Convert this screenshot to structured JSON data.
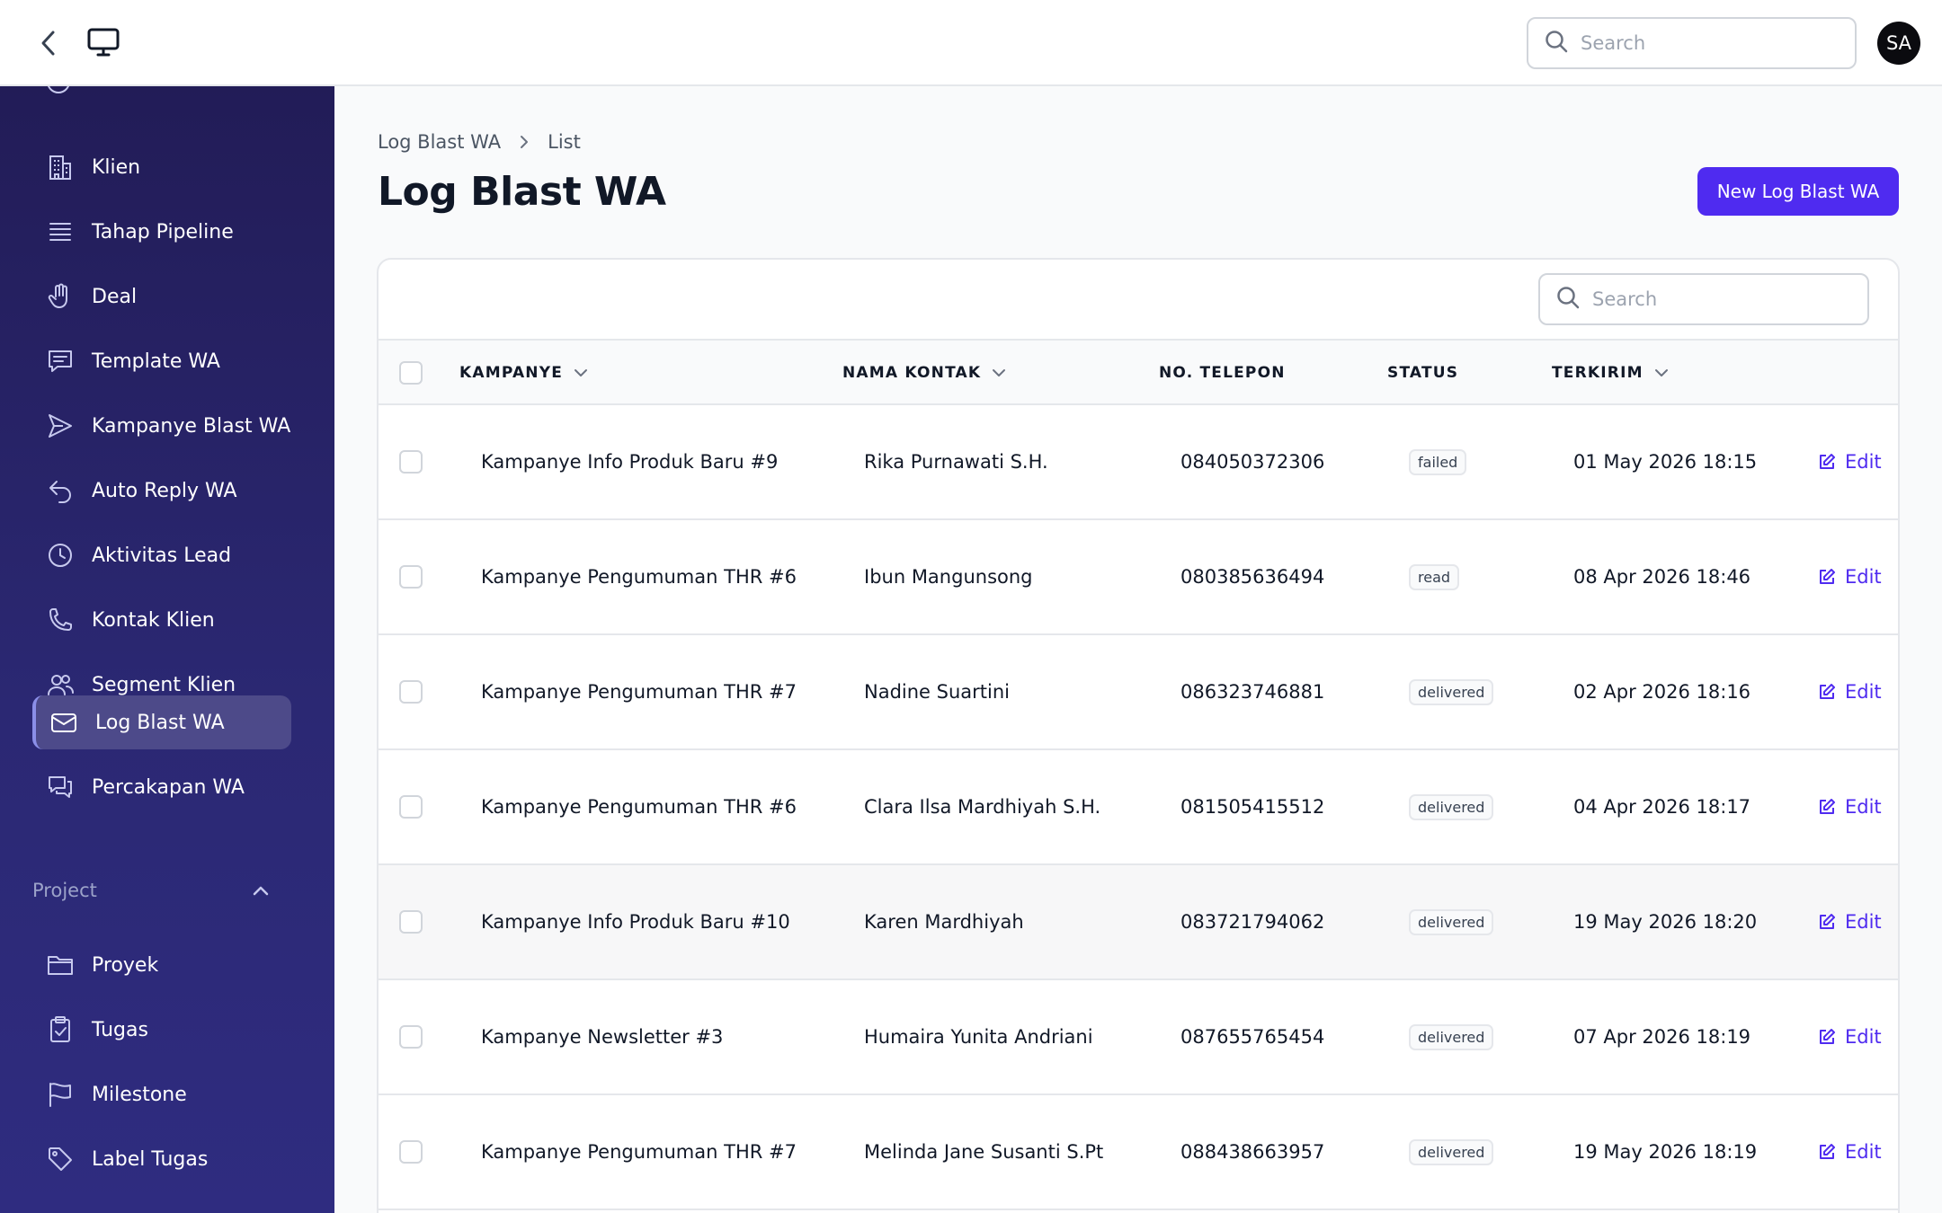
{
  "header": {
    "search_placeholder": "Search",
    "avatar_initials": "SA"
  },
  "sidebar": {
    "items": [
      {
        "label": "Klien",
        "icon": "building-icon"
      },
      {
        "label": "Tahap Pipeline",
        "icon": "list-icon"
      },
      {
        "label": "Deal",
        "icon": "hand-icon"
      },
      {
        "label": "Template WA",
        "icon": "chat-text-icon"
      },
      {
        "label": "Kampanye Blast WA",
        "icon": "send-icon"
      },
      {
        "label": "Auto Reply WA",
        "icon": "reply-icon"
      },
      {
        "label": "Aktivitas Lead",
        "icon": "clock-icon"
      },
      {
        "label": "Kontak Klien",
        "icon": "phone-icon"
      },
      {
        "label": "Segment Klien",
        "icon": "users-icon"
      },
      {
        "label": "Log Blast WA",
        "icon": "envelope-icon",
        "active": true
      },
      {
        "label": "Percakapan WA",
        "icon": "chat-bubbles-icon"
      }
    ],
    "section_label": "Project",
    "project_items": [
      {
        "label": "Proyek",
        "icon": "folder-icon"
      },
      {
        "label": "Tugas",
        "icon": "clipboard-check-icon"
      },
      {
        "label": "Milestone",
        "icon": "flag-icon"
      },
      {
        "label": "Label Tugas",
        "icon": "tag-icon"
      }
    ]
  },
  "breadcrumb": {
    "parent": "Log Blast WA",
    "current": "List"
  },
  "page": {
    "title": "Log Blast WA",
    "new_button": "New Log Blast WA"
  },
  "table": {
    "search_placeholder": "Search",
    "columns": [
      "KAMPANYE",
      "NAMA KONTAK",
      "NO. TELEPON",
      "STATUS",
      "TERKIRIM"
    ],
    "edit_label": "Edit",
    "rows": [
      {
        "kampanye": "Kampanye Info Produk Baru #9",
        "nama": "Rika Purnawati S.H.",
        "telepon": "084050372306",
        "status": "failed",
        "terkirim": "01 May 2026 18:15"
      },
      {
        "kampanye": "Kampanye Pengumuman THR #6",
        "nama": "Ibun Mangunsong",
        "telepon": "080385636494",
        "status": "read",
        "terkirim": "08 Apr 2026 18:46"
      },
      {
        "kampanye": "Kampanye Pengumuman THR #7",
        "nama": "Nadine Suartini",
        "telepon": "086323746881",
        "status": "delivered",
        "terkirim": "02 Apr 2026 18:16"
      },
      {
        "kampanye": "Kampanye Pengumuman THR #6",
        "nama": "Clara Ilsa Mardhiyah S.H.",
        "telepon": "081505415512",
        "status": "delivered",
        "terkirim": "04 Apr 2026 18:17"
      },
      {
        "kampanye": "Kampanye Info Produk Baru #10",
        "nama": "Karen Mardhiyah",
        "telepon": "083721794062",
        "status": "delivered",
        "terkirim": "19 May 2026 18:20"
      },
      {
        "kampanye": "Kampanye Newsletter #3",
        "nama": "Humaira Yunita Andriani",
        "telepon": "087655765454",
        "status": "delivered",
        "terkirim": "07 Apr 2026 18:19"
      },
      {
        "kampanye": "Kampanye Pengumuman THR #7",
        "nama": "Melinda Jane Susanti S.Pt",
        "telepon": "088438663957",
        "status": "delivered",
        "terkirim": "19 May 2026 18:19"
      }
    ]
  },
  "colors": {
    "accent": "#4f2bf0",
    "sidebar_top": "#221c57",
    "sidebar_bottom": "#2f2c80"
  }
}
